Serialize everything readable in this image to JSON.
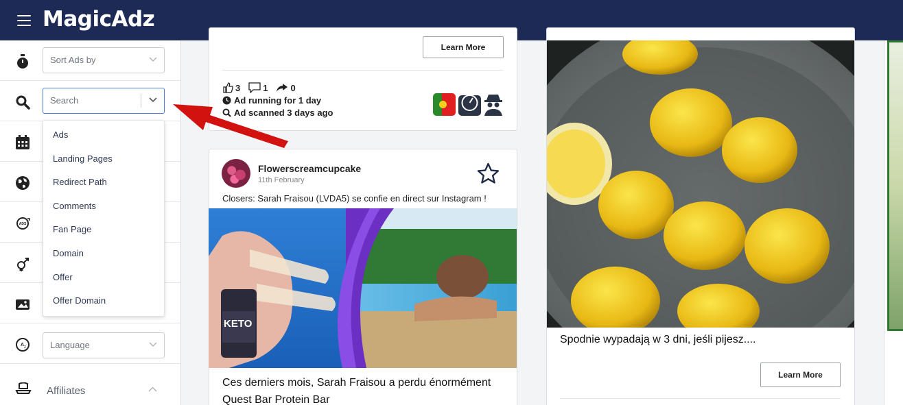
{
  "app": {
    "logo": "MagicAdz"
  },
  "sidebar": {
    "sort": {
      "placeholder": "Sort Ads by"
    },
    "search": {
      "placeholder": "Search"
    },
    "dropdown_options": [
      "Ads",
      "Landing Pages",
      "Redirect Path",
      "Comments",
      "Fan Page",
      "Domain",
      "Offer",
      "Offer Domain"
    ],
    "language": {
      "placeholder": "Language"
    },
    "affiliates_label": "Affiliates",
    "icons": [
      "stopwatch-icon",
      "search-icon",
      "calendar-icon",
      "globe-icon",
      "ads-icon",
      "gender-icon",
      "image-icon",
      "language-icon",
      "affiliates-icon"
    ]
  },
  "card1": {
    "button": "Learn More",
    "likes": "3",
    "comments": "1",
    "shares": "0",
    "running": "Ad running for 1 day",
    "scanned": "Ad scanned 3 days ago"
  },
  "card2": {
    "page_name": "Flowerscreamcupcake",
    "date": "11th February",
    "text": "Closers: Sarah Fraisou (LVDA5) se confie en direct sur Instagram !",
    "title": "Ces derniers mois, Sarah Fraisou a perdu énormément Quest Bar Protein Bar",
    "product_label": "KETO"
  },
  "card3": {
    "caption": "Spodnie wypadają w 3 dni, jeśli pijesz....",
    "button": "Learn More"
  },
  "colors": {
    "topbar": "#1d2a55",
    "arrow": "#d2120f",
    "active_border": "#4a7bd0"
  }
}
